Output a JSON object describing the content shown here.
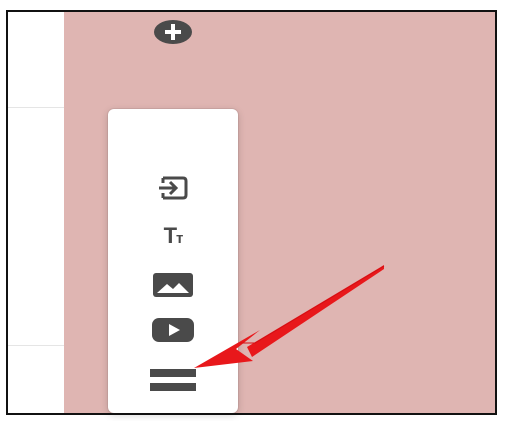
{
  "toolbar": {
    "tools": [
      {
        "icon": "add-circle-icon"
      },
      {
        "icon": "import-icon"
      },
      {
        "icon": "title-text-icon",
        "label": "Tт"
      },
      {
        "icon": "image-icon"
      },
      {
        "icon": "video-icon"
      },
      {
        "icon": "divider-icon"
      }
    ]
  },
  "colors": {
    "canvas_background": "#dfb5b2",
    "toolbar_background": "#ffffff",
    "icon": "#4a4a4a",
    "arrow": "#e8181b"
  }
}
